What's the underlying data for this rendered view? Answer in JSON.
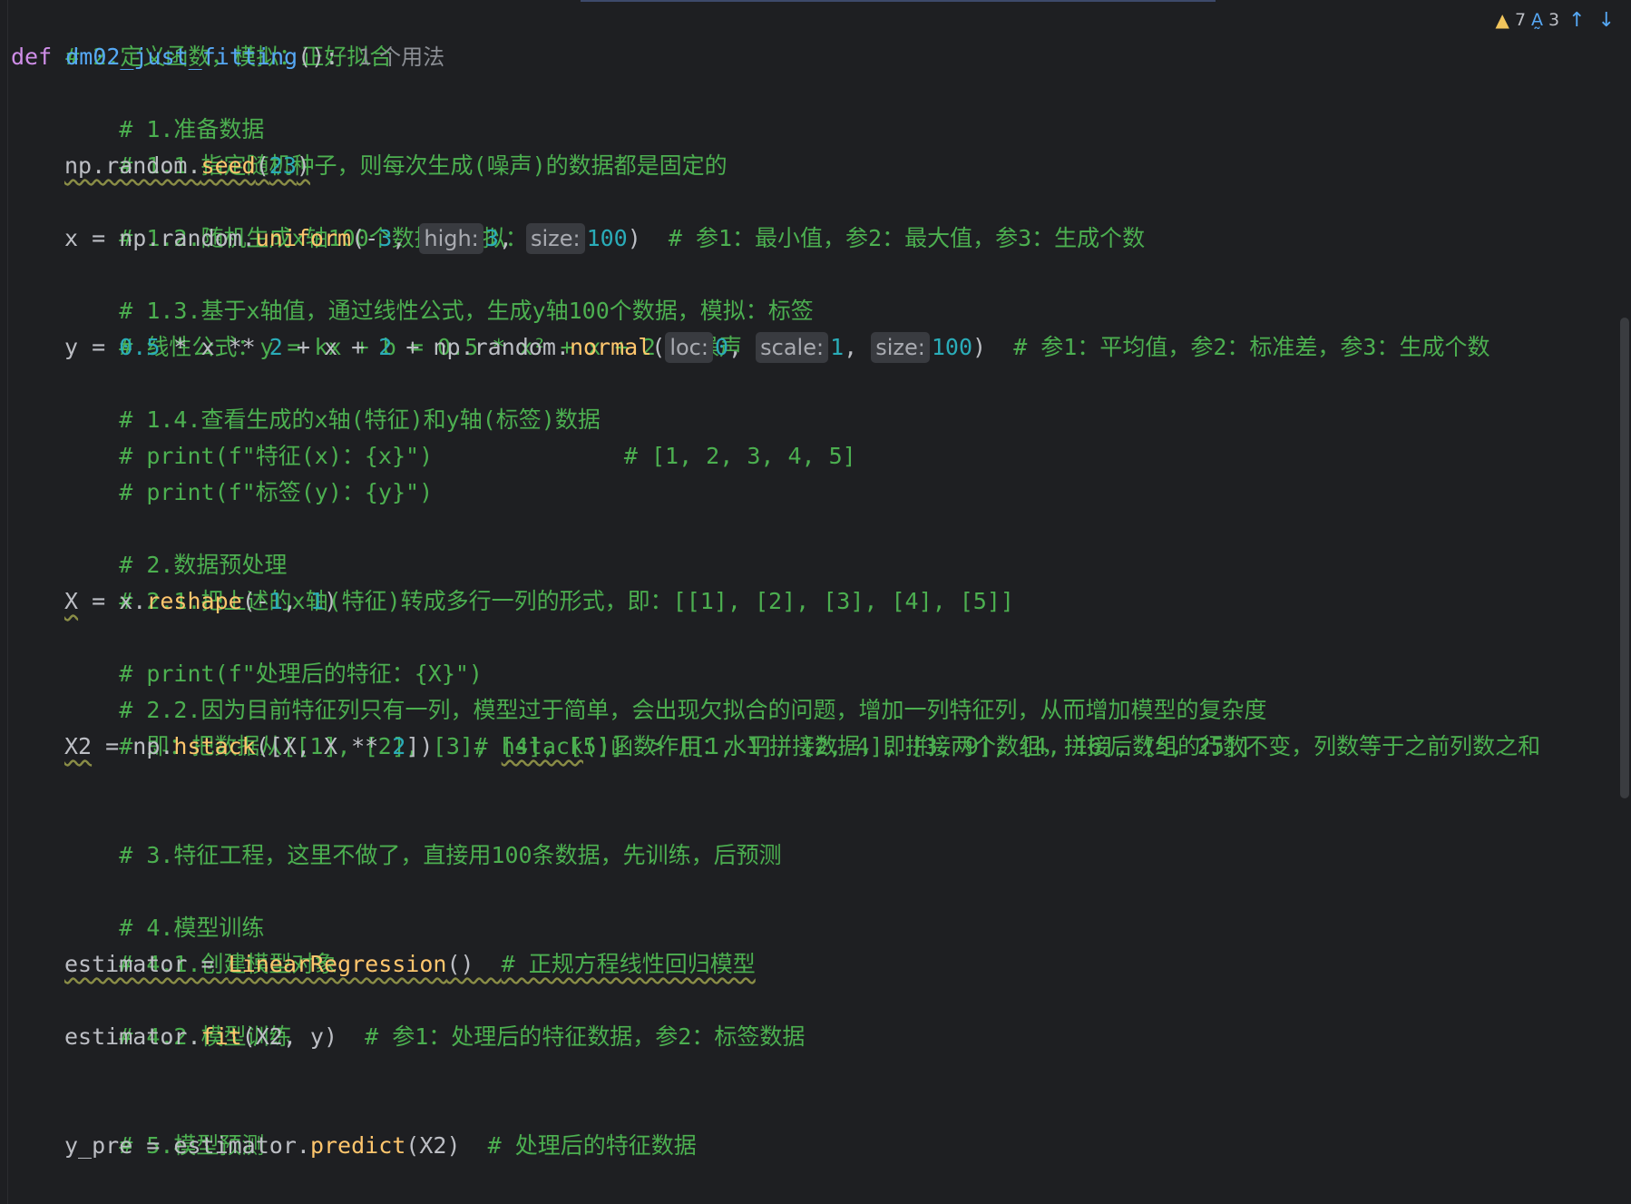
{
  "status": {
    "warnings": "7",
    "typos": "3",
    "up_arrow": "↑",
    "down_arrow": "↓"
  },
  "code": {
    "l0": {
      "comment": "# 2.定义函数，模拟：正好拟合"
    },
    "l1": {
      "kw": "def",
      "fname": "dm02_just_fitting",
      "rest": "():",
      "usage": "1 个用法"
    },
    "l2": {
      "comment": "# 1.准备数据"
    },
    "l3": {
      "comment": "# 1.1.指定随机种子，则每次生成(噪声)的数据都是固定的"
    },
    "l4": {
      "a": "np.random.",
      "fn": "seed",
      "b": "(",
      "n": "23",
      "c": ")"
    },
    "l5": {
      "comment": "# 1.2.随机生成x轴100个数据，模拟：特征"
    },
    "l6": {
      "a": "x = np.random.",
      "fn": "uniform",
      "b": "(-",
      "n1": "3",
      "c": ", ",
      "h1": "high:",
      "n2": "3",
      "d": ", ",
      "h2": "size:",
      "n3": "100",
      "e": ")  ",
      "comment": "# 参1：最小值，参2：最大值，参3：生成个数"
    },
    "l7": {
      "comment": "# 1.3.基于x轴值，通过线性公式，生成y轴100个数据，模拟：标签"
    },
    "l8": {
      "comment": "# 线性公式：y = kx + b = 0.5 * x² + x + 2 + 噪声"
    },
    "l9": {
      "a": "y = ",
      "n1": "0.5",
      "b": " * x ** ",
      "n2": "2",
      "c": " + x + ",
      "n3": "2",
      "d": " + np.random.",
      "fn": "normal",
      "e": "(",
      "h1": "loc:",
      "n4": "0",
      "f": ", ",
      "h2": "scale:",
      "n5": "1",
      "g": ", ",
      "h3": "size:",
      "n6": "100",
      "h": ")  ",
      "comment": "# 参1：平均值，参2：标准差，参3：生成个数"
    },
    "l10": {
      "comment": "# 1.4.查看生成的x轴(特征)和y轴(标签)数据"
    },
    "l11": {
      "comment": "# print(f\"特征(x)：{x}\")              # [1, 2, 3, 4, 5]"
    },
    "l12": {
      "comment": "# print(f\"标签(y)：{y}\")"
    },
    "l14": {
      "comment": "# 2.数据预处理"
    },
    "l15": {
      "comment": "# 2.1.把上述的x轴(特征)转成多行一列的形式，即：[[1], [2], [3], [4], [5]]"
    },
    "l16": {
      "var": "X",
      "a": " = x.",
      "fn": "reshape",
      "b": "(-",
      "n1": "1",
      "c": ", ",
      "n2": "1",
      "d": ")"
    },
    "l17": {
      "comment": "# print(f\"处理后的特征：{X}\")"
    },
    "l18": {
      "comment": "# 2.2.因为目前特征列只有一列，模型过于简单，会出现欠拟合的问题，增加一列特征列，从而增加模型的复杂度"
    },
    "l19": {
      "comment": "# 即：把数据从[[1], [2], [3], [4], [5]] -> [[1, 1], [2, 4], [3, 9], [4, 16], [5, 25]]"
    },
    "l20": {
      "var": "X2",
      "a": " = np.",
      "fn": "hstack",
      "b": "([X, X ** ",
      "n": "2",
      "c": "])   ",
      "c1": "# ",
      "c2": "hstack",
      "c3": "()函数作用：水平拼接数据，即拼接两个数组，拼接后数组的行数不变，列数等于之前列数之和"
    },
    "l22": {
      "comment": "# 3.特征工程，这里不做了，直接用100条数据，先训练，后预测"
    },
    "l24": {
      "comment": "# 4.模型训练"
    },
    "l25": {
      "comment": "# 4.1.创建模型对象"
    },
    "l26": {
      "a": "estimator = ",
      "cls": "LinearRegression",
      "b": "()  ",
      "comment": "# 正规方程线性回归模型"
    },
    "l27": {
      "comment": "# 4.2.模型训练"
    },
    "l28": {
      "a": "estimator.",
      "fn": "fit",
      "b": "(X2, y)  ",
      "comment": "# 参1：处理后的特征数据，参2：标签数据"
    },
    "l30": {
      "comment": "# 5.模型预测"
    },
    "l31": {
      "a": "y_pre = estimator.",
      "fn": "predict",
      "b": "(X2)  ",
      "comment": "# 处理后的特征数据"
    }
  }
}
